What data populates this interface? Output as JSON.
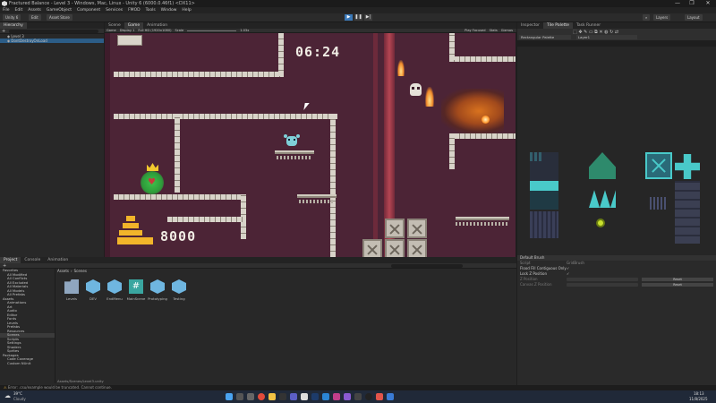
{
  "window": {
    "title": "Fractured Balance - Level 3 - Windows, Mac, Linux - Unity 6 (6000.0.46f1) <DX11>",
    "controls": [
      "—",
      "❐",
      "✕"
    ]
  },
  "menu": [
    "File",
    "Edit",
    "Assets",
    "GameObject",
    "Component",
    "Services",
    "FMOD",
    "Tools",
    "Window",
    "Help"
  ],
  "toolbar": {
    "account": "Unity 6",
    "dropdown": "Edit",
    "asset_store": "Asset Store",
    "layers": "Layers",
    "layout": "Layout"
  },
  "hierarchy": {
    "tab": "Hierarchy",
    "search_placeholder": "",
    "items": [
      "Level 3",
      "DontDestroyOnLoad"
    ]
  },
  "scene_tabs": [
    "Scene",
    "Game",
    "Animation"
  ],
  "game_toolbar": {
    "display": "Game",
    "display_num": "Display 1",
    "resolution": "Full HD (1920x1080)",
    "scale_label": "Scale",
    "scale_value": "1.03x",
    "play_focused": "Play Focused",
    "stats": "Stats",
    "gizmos": "Gizmos"
  },
  "game": {
    "timer": "06:24",
    "score": "8000"
  },
  "inspector": {
    "tabs": [
      "Inspector",
      "Tile Palette",
      "Task Runner"
    ],
    "palette_name": "Rectangular Palette",
    "layer_name": "Layer1",
    "default_brush": "Default Brush",
    "brush_rows": [
      {
        "label": "Script",
        "value": "GridBrush"
      },
      {
        "label": "Flood Fill Contiguous Only",
        "value": "✓"
      },
      {
        "label": "Lock Z Position",
        "value": "✓"
      },
      {
        "label": "Z Position",
        "value": "0"
      },
      {
        "label": "Canvas Z Position",
        "value": ""
      }
    ],
    "buttons": [
      "Reset",
      "Reset"
    ]
  },
  "project": {
    "tabs": [
      "Project",
      "Console",
      "Animation"
    ],
    "breadcrumb": [
      "Assets",
      "Scenes"
    ],
    "tree": [
      "Favorites",
      "All Modified",
      "All Conflicts",
      "All Excluded",
      "All Materials",
      "All Models",
      "All Prefabs",
      "Assets",
      "Animations",
      "Art",
      "Audio",
      "Editor",
      "Fonts",
      "Levels",
      "Prefabs",
      "Resources",
      "Scenes",
      "Scripts",
      "Settings",
      "Shaders",
      "Sprites",
      "Packages",
      "Code Coverage",
      "Custom NUnit"
    ],
    "assets": [
      {
        "name": "Levels",
        "icon": "folder-icon"
      },
      {
        "name": "DEV",
        "icon": "unity-scene-icon"
      },
      {
        "name": "EndMenu",
        "icon": "unity-scene-icon"
      },
      {
        "name": "MainScene",
        "icon": "script-icon"
      },
      {
        "name": "Prototyping",
        "icon": "unity-scene-icon"
      },
      {
        "name": "Testing",
        "icon": "unity-scene-icon"
      }
    ],
    "footer_path": "Assets/Scenes/Level3.unity"
  },
  "status": {
    "message": "Error: .csu/example would be truncated. Cannot continue."
  },
  "taskbar": {
    "weather_temp": "39°C",
    "weather_desc": "Cloudy",
    "time": "18:13",
    "date": "11/8/2025"
  },
  "colors": {
    "accent": "#3a78b8",
    "scene_bg": "#4c2436",
    "selection": "#2c5d87",
    "palette_cyan": "#49c9c9",
    "heart_green": "#2e9b3a",
    "fire": "#f08a2a"
  }
}
